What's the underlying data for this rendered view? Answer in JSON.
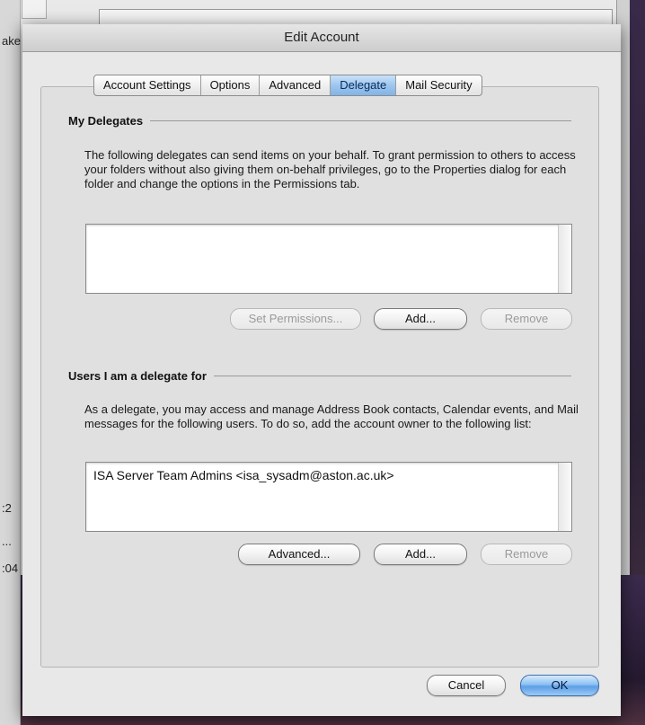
{
  "background": {
    "left_fragments": [
      "ake",
      ":2",
      "...",
      ":04"
    ]
  },
  "dialog": {
    "title": "Edit Account",
    "tabs": [
      {
        "label": "Account Settings",
        "active": false
      },
      {
        "label": "Options",
        "active": false
      },
      {
        "label": "Advanced",
        "active": false
      },
      {
        "label": "Delegate",
        "active": true
      },
      {
        "label": "Mail Security",
        "active": false
      }
    ],
    "my_delegates": {
      "title": "My Delegates",
      "description": "The following delegates can send items on your behalf. To grant permission to others to access your folders without also giving them on-behalf privileges, go to the Properties dialog for each folder and change the options in the Permissions tab.",
      "items": [],
      "buttons": {
        "set_permissions": "Set Permissions...",
        "add": "Add...",
        "remove": "Remove"
      }
    },
    "delegate_for": {
      "title": "Users I am a delegate for",
      "description": "As a delegate, you may access and manage Address Book contacts, Calendar events, and Mail messages for the following users. To do so, add the account owner to the following list:",
      "items": [
        "ISA Server Team Admins <isa_sysadm@aston.ac.uk>"
      ],
      "buttons": {
        "advanced": "Advanced...",
        "add": "Add...",
        "remove": "Remove"
      }
    },
    "footer": {
      "cancel": "Cancel",
      "ok": "OK"
    }
  },
  "colors": {
    "accent": "#5d9ee6",
    "active_tab": "#9dc6ee"
  }
}
